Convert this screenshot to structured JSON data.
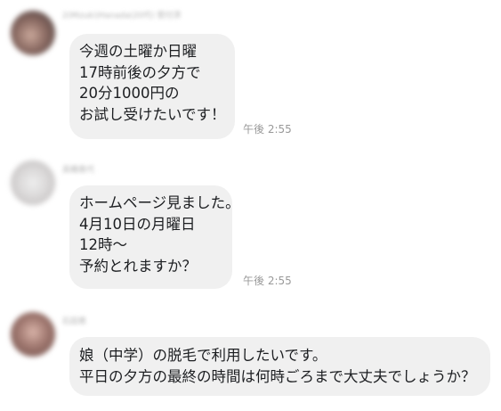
{
  "conversation": {
    "messages": [
      {
        "sender": "2(Mizuki)Hanada(20代) 受付済",
        "lines": [
          "今週の土曜か日曜",
          "17時前後の夕方で",
          "20分1000円の",
          "お試し受けたいです！"
        ],
        "time": "午後 2:55"
      },
      {
        "sender": "高橋香代",
        "lines": [
          "ホームページ見ました。",
          "4月10日の月曜日",
          "12時〜",
          "予約とれますか？"
        ],
        "time": "午後 2:55"
      },
      {
        "sender": "石田恵",
        "lines": [
          "娘（中学）の脱毛で利用したいです。",
          "平日の夕方の最終の時間は何時ごろまで大丈夫でしょうか？"
        ],
        "time": ""
      }
    ]
  },
  "colors": {
    "bubble": "#f0f0f0",
    "text": "#1c1e21",
    "timestamp": "#999999"
  }
}
